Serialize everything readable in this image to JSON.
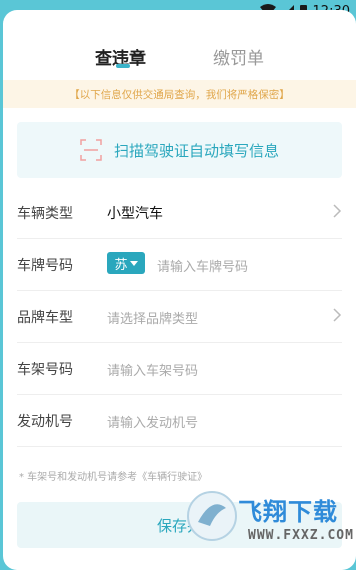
{
  "status_bar": {
    "time": "12:30"
  },
  "tabs": [
    {
      "label": "查违章",
      "active": true
    },
    {
      "label": "缴罚单",
      "active": false
    }
  ],
  "notice": "【以下信息仅供交通局查询，我们将严格保密】",
  "scan": {
    "label": "扫描驾驶证自动填写信息",
    "icon": "scan-icon"
  },
  "form": {
    "vehicle_type": {
      "label": "车辆类型",
      "value": "小型汽车"
    },
    "plate": {
      "label": "车牌号码",
      "province": "苏",
      "placeholder": "请输入车牌号码"
    },
    "brand": {
      "label": "品牌车型",
      "placeholder": "请选择品牌类型"
    },
    "vin": {
      "label": "车架号码",
      "placeholder": "请输入车架号码"
    },
    "engine": {
      "label": "发动机号",
      "placeholder": "请输入发动机号"
    }
  },
  "footnote": "* 车架号和发动机号请参考《车辆行驶证》",
  "save_button": "保存并",
  "watermark": {
    "text": "飞翔下载",
    "url": "WWW.FXXZ.COM"
  },
  "colors": {
    "accent": "#2aa7bd",
    "background": "#5ac6d6",
    "notice_text": "#e0a64a"
  }
}
